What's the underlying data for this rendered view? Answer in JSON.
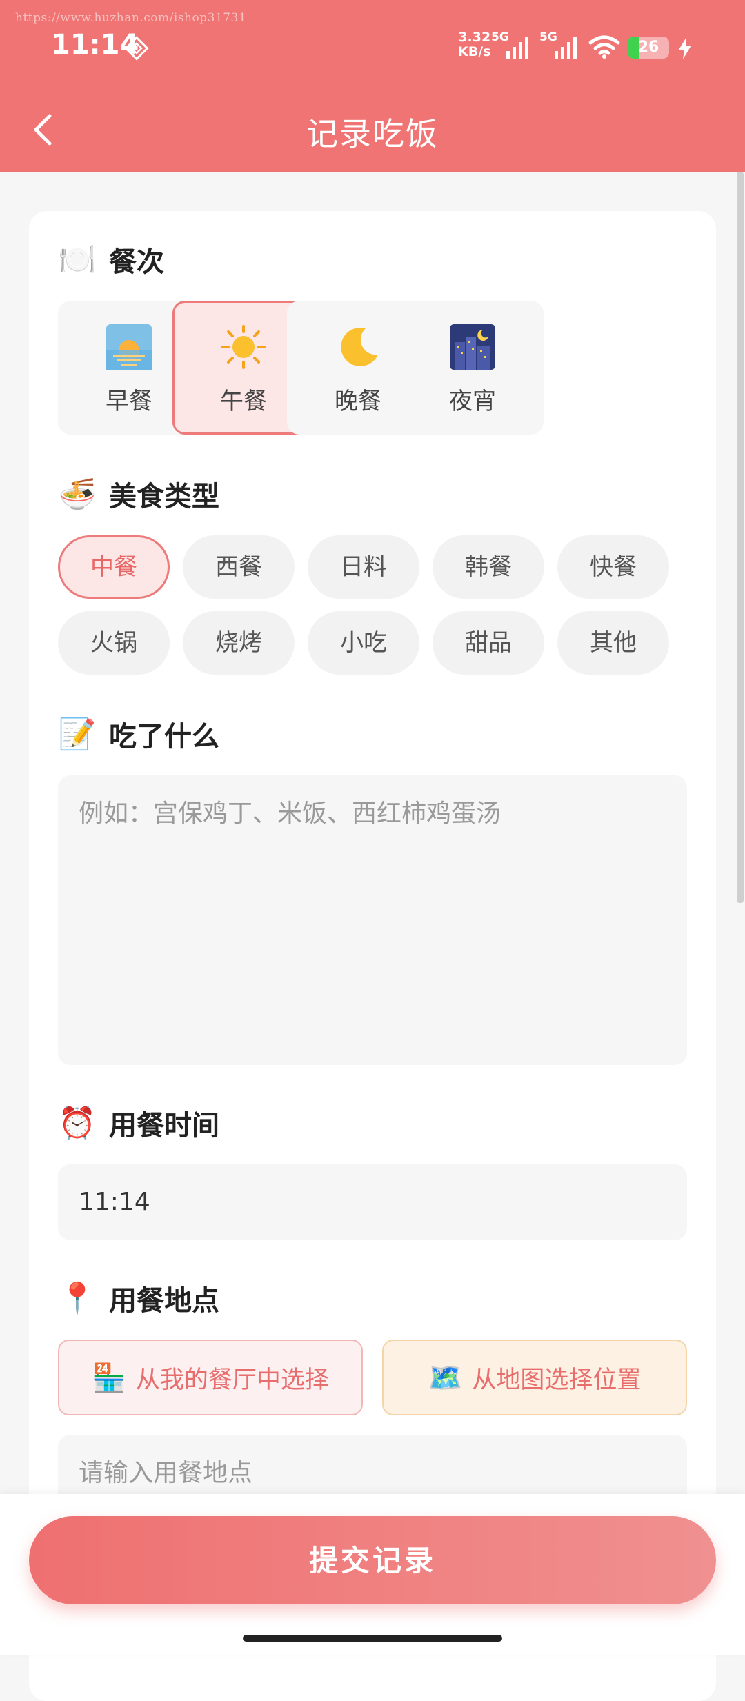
{
  "status_bar": {
    "watermark": "https://www.huzhan.com/ishop31731",
    "time": "11:14",
    "net_speed_value": "3.32",
    "net_speed_unit": "KB/s",
    "sim1_label": "5G",
    "sim2_label": "5G",
    "battery_level": "26"
  },
  "nav": {
    "title": "记录吃饭"
  },
  "meal_section": {
    "title": "餐次",
    "options": [
      {
        "label": "早餐",
        "icon": "sunrise-icon",
        "selected": false
      },
      {
        "label": "午餐",
        "icon": "sun-icon",
        "selected": true
      },
      {
        "label": "晚餐",
        "icon": "moon-icon",
        "selected": false
      },
      {
        "label": "夜宵",
        "icon": "night-city-icon",
        "selected": false
      }
    ]
  },
  "cuisine_section": {
    "title": "美食类型",
    "options": [
      "中餐",
      "西餐",
      "日料",
      "韩餐",
      "快餐",
      "火锅",
      "烧烤",
      "小吃",
      "甜品",
      "其他"
    ],
    "selected": "中餐"
  },
  "food_section": {
    "title": "吃了什么",
    "placeholder": "例如：宫保鸡丁、米饭、西红柿鸡蛋汤"
  },
  "time_section": {
    "title": "用餐时间",
    "value": "11:14"
  },
  "place_section": {
    "title": "用餐地点",
    "choose_restaurant": "从我的餐厅中选择",
    "choose_map": "从地图选择位置",
    "placeholder": "请输入用餐地点"
  },
  "submit": {
    "label": "提交记录"
  },
  "colors": {
    "accent": "#ef7473",
    "selected_bg": "#fde6e6",
    "map_btn_bg": "#fdf1e3"
  }
}
